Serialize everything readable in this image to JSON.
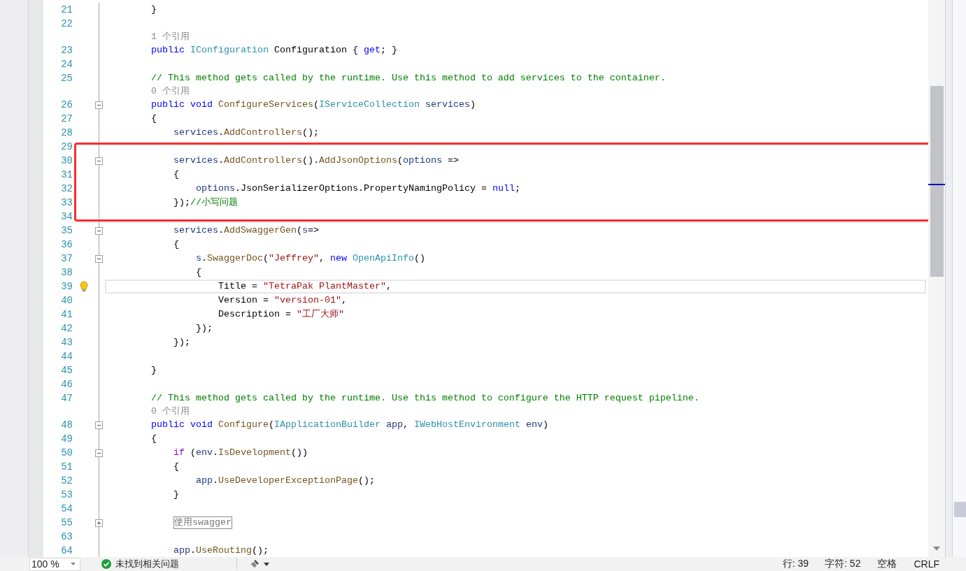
{
  "editor": {
    "lines": [
      {
        "kind": "code",
        "number": "21",
        "current": false,
        "lightbulb": false,
        "tokens": [
          {
            "kind": "plain",
            "t": "        }"
          }
        ]
      },
      {
        "kind": "code",
        "number": "22",
        "current": false,
        "lightbulb": false
      },
      {
        "kind": "codelens",
        "text": "        1 个引用"
      },
      {
        "kind": "code",
        "number": "23",
        "current": false,
        "lightbulb": false,
        "tokens": [
          {
            "kind": "kw",
            "t": "        public "
          },
          {
            "kind": "type",
            "t": "IConfiguration"
          },
          {
            "kind": "plain",
            "t": " Configuration { "
          },
          {
            "kind": "kw",
            "t": "get"
          },
          {
            "kind": "plain",
            "t": "; }"
          }
        ]
      },
      {
        "kind": "code",
        "number": "24",
        "current": false,
        "lightbulb": false
      },
      {
        "kind": "code",
        "number": "25",
        "current": false,
        "lightbulb": false,
        "tokens": [
          {
            "kind": "comment",
            "t": "        // This method gets called by the runtime. Use this method to add services to the container."
          }
        ]
      },
      {
        "kind": "codelens",
        "text": "        0 个引用"
      },
      {
        "kind": "code",
        "number": "26",
        "expanded": true,
        "current": false,
        "lightbulb": false,
        "tokens": [
          {
            "kind": "kw",
            "t": "        public void "
          },
          {
            "kind": "method",
            "t": "ConfigureServices"
          },
          {
            "kind": "plain",
            "t": "("
          },
          {
            "kind": "type",
            "t": "IServiceCollection"
          },
          {
            "kind": "param",
            "t": " services"
          },
          {
            "kind": "plain",
            "t": ")"
          }
        ]
      },
      {
        "kind": "code",
        "number": "27",
        "current": false,
        "lightbulb": false,
        "tokens": [
          {
            "kind": "plain",
            "t": "        {"
          }
        ]
      },
      {
        "kind": "code",
        "number": "28",
        "current": false,
        "lightbulb": false,
        "tokens": [
          {
            "kind": "param",
            "t": "            services"
          },
          {
            "kind": "plain",
            "t": "."
          },
          {
            "kind": "method",
            "t": "AddControllers"
          },
          {
            "kind": "plain",
            "t": "();"
          }
        ]
      },
      {
        "kind": "code",
        "number": "29",
        "current": false,
        "lightbulb": false
      },
      {
        "kind": "code",
        "number": "30",
        "expanded": true,
        "current": false,
        "lightbulb": false,
        "tokens": [
          {
            "kind": "param",
            "t": "            services"
          },
          {
            "kind": "plain",
            "t": "."
          },
          {
            "kind": "method",
            "t": "AddControllers"
          },
          {
            "kind": "plain",
            "t": "()."
          },
          {
            "kind": "method",
            "t": "AddJsonOptions"
          },
          {
            "kind": "plain",
            "t": "("
          },
          {
            "kind": "param",
            "t": "options"
          },
          {
            "kind": "plain",
            "t": " =>"
          }
        ]
      },
      {
        "kind": "code",
        "number": "31",
        "current": false,
        "lightbulb": false,
        "tokens": [
          {
            "kind": "plain",
            "t": "            {"
          }
        ]
      },
      {
        "kind": "code",
        "number": "32",
        "current": false,
        "lightbulb": false,
        "tokens": [
          {
            "kind": "param",
            "t": "                options"
          },
          {
            "kind": "plain",
            "t": ".JsonSerializerOptions.PropertyNamingPolicy = "
          },
          {
            "kind": "kw",
            "t": "null"
          },
          {
            "kind": "plain",
            "t": ";"
          }
        ]
      },
      {
        "kind": "code",
        "number": "33",
        "current": false,
        "lightbulb": false,
        "tokens": [
          {
            "kind": "plain",
            "t": "            });"
          },
          {
            "kind": "comment",
            "t": "//小写问题"
          }
        ]
      },
      {
        "kind": "code",
        "number": "34",
        "current": false,
        "lightbulb": false
      },
      {
        "kind": "code",
        "number": "35",
        "expanded": true,
        "current": false,
        "lightbulb": false,
        "tokens": [
          {
            "kind": "param",
            "t": "            services"
          },
          {
            "kind": "plain",
            "t": "."
          },
          {
            "kind": "method",
            "t": "AddSwaggerGen"
          },
          {
            "kind": "plain",
            "t": "("
          },
          {
            "kind": "param",
            "t": "s"
          },
          {
            "kind": "plain",
            "t": "=>"
          }
        ]
      },
      {
        "kind": "code",
        "number": "36",
        "current": false,
        "lightbulb": false,
        "tokens": [
          {
            "kind": "plain",
            "t": "            {"
          }
        ]
      },
      {
        "kind": "code",
        "number": "37",
        "expanded": true,
        "current": false,
        "lightbulb": false,
        "tokens": [
          {
            "kind": "param",
            "t": "                s"
          },
          {
            "kind": "plain",
            "t": "."
          },
          {
            "kind": "method",
            "t": "SwaggerDoc"
          },
          {
            "kind": "plain",
            "t": "("
          },
          {
            "kind": "str",
            "t": "\"Jeffrey\""
          },
          {
            "kind": "plain",
            "t": ", "
          },
          {
            "kind": "kw",
            "t": "new "
          },
          {
            "kind": "type",
            "t": "OpenApiInfo"
          },
          {
            "kind": "plain",
            "t": "()"
          }
        ]
      },
      {
        "kind": "code",
        "number": "38",
        "current": false,
        "lightbulb": false,
        "tokens": [
          {
            "kind": "plain",
            "t": "                {"
          }
        ]
      },
      {
        "kind": "code",
        "number": "39",
        "current": true,
        "lightbulb": true,
        "tokens": [
          {
            "kind": "plain",
            "t": "                    Title = "
          },
          {
            "kind": "str",
            "t": "\"TetraPak PlantMaster\""
          },
          {
            "kind": "plain",
            "t": ","
          }
        ]
      },
      {
        "kind": "code",
        "number": "40",
        "current": false,
        "lightbulb": false,
        "tokens": [
          {
            "kind": "plain",
            "t": "                    Version = "
          },
          {
            "kind": "str",
            "t": "\"version-01\""
          },
          {
            "kind": "plain",
            "t": ","
          }
        ]
      },
      {
        "kind": "code",
        "number": "41",
        "current": false,
        "lightbulb": false,
        "tokens": [
          {
            "kind": "plain",
            "t": "                    Description = "
          },
          {
            "kind": "str",
            "t": "\"工厂大师\""
          }
        ]
      },
      {
        "kind": "code",
        "number": "42",
        "current": false,
        "lightbulb": false,
        "tokens": [
          {
            "kind": "plain",
            "t": "                });"
          }
        ]
      },
      {
        "kind": "code",
        "number": "43",
        "current": false,
        "lightbulb": false,
        "tokens": [
          {
            "kind": "plain",
            "t": "            });"
          }
        ]
      },
      {
        "kind": "code",
        "number": "44",
        "current": false,
        "lightbulb": false
      },
      {
        "kind": "code",
        "number": "45",
        "current": false,
        "lightbulb": false,
        "tokens": [
          {
            "kind": "plain",
            "t": "        }"
          }
        ]
      },
      {
        "kind": "code",
        "number": "46",
        "current": false,
        "lightbulb": false
      },
      {
        "kind": "code",
        "number": "47",
        "current": false,
        "lightbulb": false,
        "tokens": [
          {
            "kind": "comment",
            "t": "        // This method gets called by the runtime. Use this method to configure the HTTP request pipeline."
          }
        ]
      },
      {
        "kind": "codelens",
        "text": "        0 个引用"
      },
      {
        "kind": "code",
        "number": "48",
        "expanded": true,
        "current": false,
        "lightbulb": false,
        "tokens": [
          {
            "kind": "kw",
            "t": "        public void "
          },
          {
            "kind": "method",
            "t": "Configure"
          },
          {
            "kind": "plain",
            "t": "("
          },
          {
            "kind": "type",
            "t": "IApplicationBuilder"
          },
          {
            "kind": "param",
            "t": " app"
          },
          {
            "kind": "plain",
            "t": ", "
          },
          {
            "kind": "type",
            "t": "IWebHostEnvironment"
          },
          {
            "kind": "param",
            "t": " env"
          },
          {
            "kind": "plain",
            "t": ")"
          }
        ]
      },
      {
        "kind": "code",
        "number": "49",
        "current": false,
        "lightbulb": false,
        "tokens": [
          {
            "kind": "plain",
            "t": "        {"
          }
        ]
      },
      {
        "kind": "code",
        "number": "50",
        "expanded": true,
        "current": false,
        "lightbulb": false,
        "tokens": [
          {
            "kind": "ctrl",
            "t": "            if"
          },
          {
            "kind": "plain",
            "t": " ("
          },
          {
            "kind": "param",
            "t": "env"
          },
          {
            "kind": "plain",
            "t": "."
          },
          {
            "kind": "method",
            "t": "IsDevelopment"
          },
          {
            "kind": "plain",
            "t": "())"
          }
        ]
      },
      {
        "kind": "code",
        "number": "51",
        "current": false,
        "lightbulb": false,
        "tokens": [
          {
            "kind": "plain",
            "t": "            {"
          }
        ]
      },
      {
        "kind": "code",
        "number": "52",
        "current": false,
        "lightbulb": false,
        "tokens": [
          {
            "kind": "param",
            "t": "                app"
          },
          {
            "kind": "plain",
            "t": "."
          },
          {
            "kind": "method",
            "t": "UseDeveloperExceptionPage"
          },
          {
            "kind": "plain",
            "t": "();"
          }
        ]
      },
      {
        "kind": "code",
        "number": "53",
        "current": false,
        "lightbulb": false,
        "tokens": [
          {
            "kind": "plain",
            "t": "            }"
          }
        ]
      },
      {
        "kind": "code",
        "number": "54",
        "current": false,
        "lightbulb": false
      },
      {
        "kind": "code",
        "number": "55",
        "expanded": false,
        "current": false,
        "lightbulb": false,
        "tokens": [
          {
            "kind": "region",
            "t": "使用swagger"
          }
        ]
      },
      {
        "kind": "code",
        "number": "63",
        "current": false,
        "lightbulb": false
      },
      {
        "kind": "code",
        "number": "64",
        "current": false,
        "lightbulb": false,
        "tokens": [
          {
            "kind": "param",
            "t": "            app"
          },
          {
            "kind": "plain",
            "t": "."
          },
          {
            "kind": "method",
            "t": "UseRouting"
          },
          {
            "kind": "plain",
            "t": "();"
          }
        ]
      }
    ]
  },
  "status_bar": {
    "zoom": "100 %",
    "issues": "未找到相关问题",
    "line": "行: 39",
    "char": "字符: 52",
    "indent": "空格",
    "line_ending": "CRLF"
  }
}
